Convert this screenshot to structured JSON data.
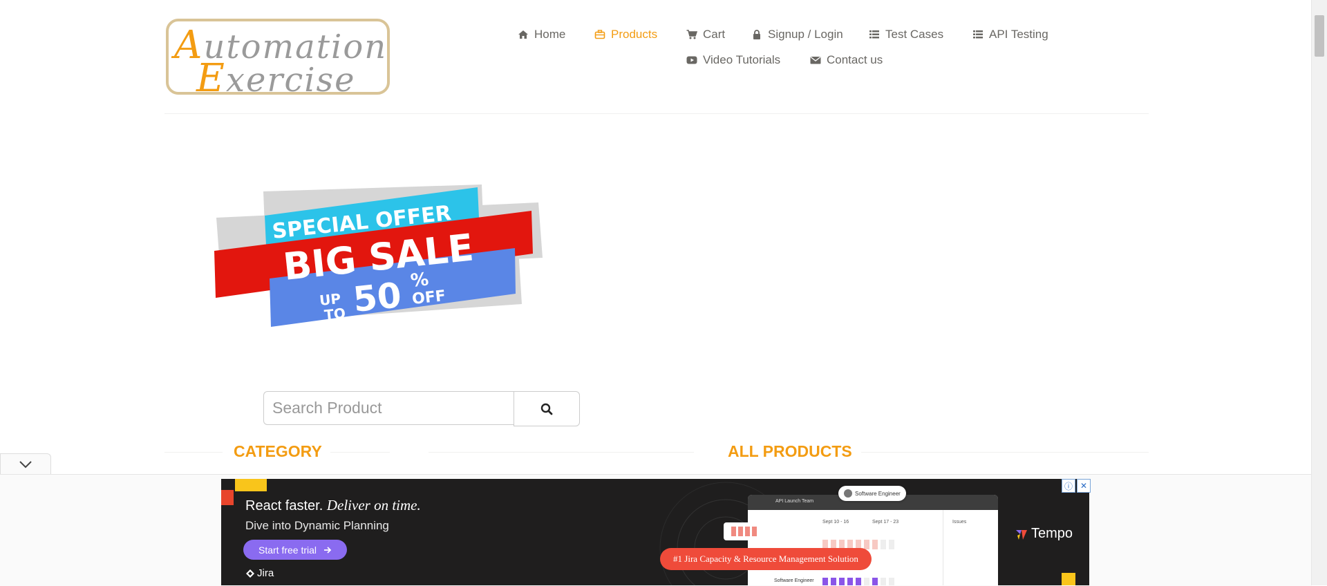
{
  "logo": {
    "line1_first": "A",
    "line1_rest": "utomation",
    "line2_first": "E",
    "line2_rest": "xercise"
  },
  "nav": {
    "items": [
      {
        "label": "Home",
        "icon": "home-icon"
      },
      {
        "label": "Products",
        "icon": "briefcase-icon",
        "active": true
      },
      {
        "label": "Cart",
        "icon": "cart-icon"
      },
      {
        "label": "Signup / Login",
        "icon": "lock-icon"
      },
      {
        "label": "Test Cases",
        "icon": "list-icon"
      },
      {
        "label": "API Testing",
        "icon": "list-icon"
      },
      {
        "label": "Video Tutorials",
        "icon": "youtube-play-icon"
      },
      {
        "label": "Contact us",
        "icon": "envelope-icon"
      }
    ]
  },
  "banner": {
    "line1": "SPECIAL OFFER",
    "line2": "BIG SALE",
    "up": "UP",
    "to": "TO",
    "amount": "50",
    "percent": "%",
    "off": "OFF"
  },
  "search": {
    "placeholder": "Search Product",
    "button_icon": "search-icon"
  },
  "sections": {
    "category": "CATEGORY",
    "all_products": "ALL PRODUCTS"
  },
  "ad": {
    "headline_plain": "React faster.",
    "headline_italic": "Deliver on time.",
    "subline": "Dive into Dynamic Planning",
    "cta": "Start free trial",
    "product": "Jira",
    "pill": "#1 Jira Capacity & Resource Management Solution",
    "brand": "Tempo",
    "chip": "Software Engineer",
    "screen_title": "API Launch Team",
    "screen_col1": "Sept 10 - 16",
    "screen_col2": "Sept 17 - 23",
    "screen_side": "Issues",
    "screen_row": "Software Engineer"
  },
  "colors": {
    "accent": "#f39c12",
    "text": "#696763",
    "ad_bg": "#1f1e1e",
    "ad_cta": "#8a6bf0",
    "ad_pill": "#ef4b3a"
  }
}
